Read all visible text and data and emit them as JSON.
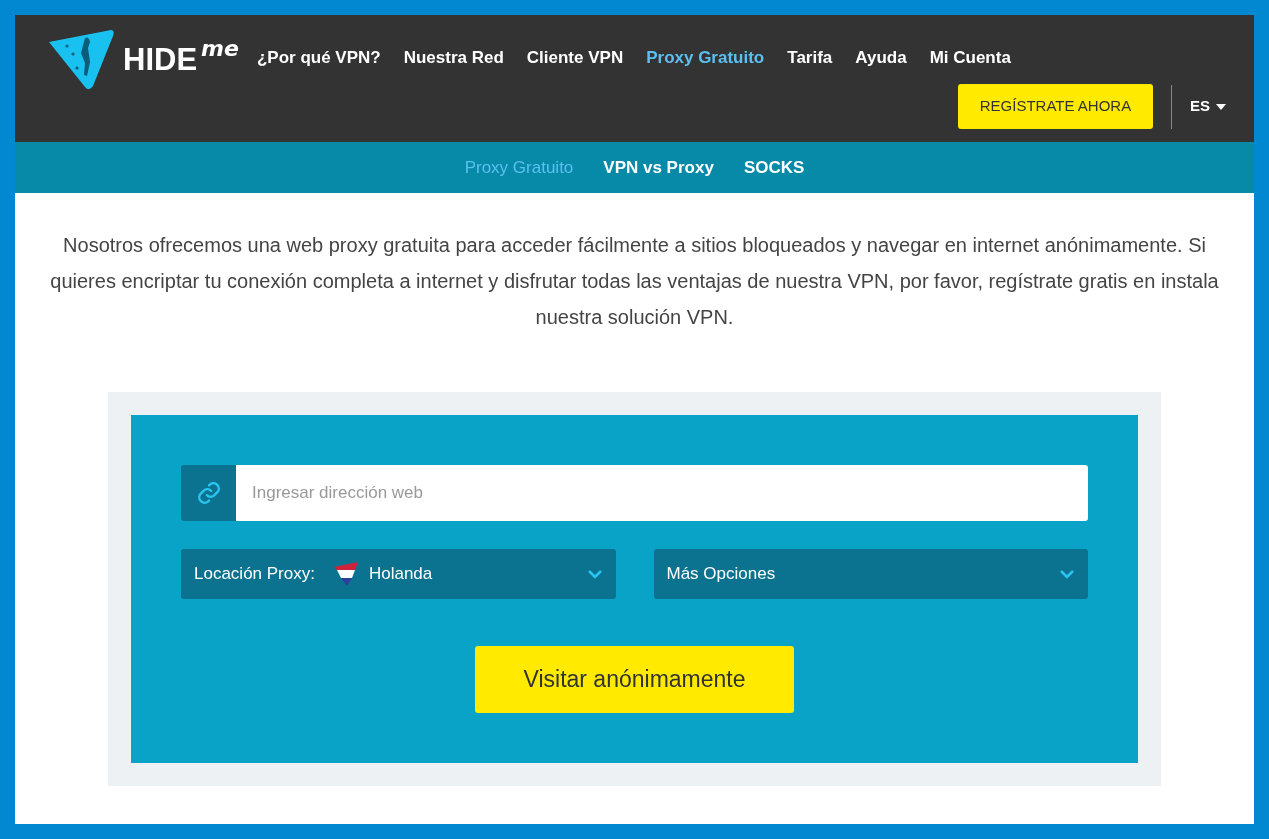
{
  "logo": {
    "word": "HIDE",
    "suffix": "me"
  },
  "nav": [
    {
      "label": "¿Por qué VPN?",
      "selected": false
    },
    {
      "label": "Nuestra Red",
      "selected": false
    },
    {
      "label": "Cliente VPN",
      "selected": false
    },
    {
      "label": "Proxy Gratuito",
      "selected": true
    },
    {
      "label": "Tarifa",
      "selected": false
    },
    {
      "label": "Ayuda",
      "selected": false
    },
    {
      "label": "Mi Cuenta",
      "selected": false
    }
  ],
  "register_button": "REGÍSTRATE AHORA",
  "language": "ES",
  "subnav": [
    {
      "label": "Proxy Gratuito",
      "selected": true
    },
    {
      "label": "VPN vs Proxy",
      "selected": false
    },
    {
      "label": "SOCKS",
      "selected": false
    }
  ],
  "intro": "Nosotros ofrecemos una web proxy gratuita para acceder fácilmente a sitios bloqueados y navegar en internet anónimamente. Si quieres encriptar tu conexión completa a internet y disfrutar todas las ventajas de nuestra VPN, por favor, regístrate gratis en instala nuestra solución VPN.",
  "proxy_form": {
    "url_field": {
      "placeholder": "Ingresar dirección web"
    },
    "location": {
      "label": "Locación Proxy:",
      "value": "Holanda"
    },
    "more_options": "Más Opciones",
    "submit": "Visitar anónimamente"
  }
}
